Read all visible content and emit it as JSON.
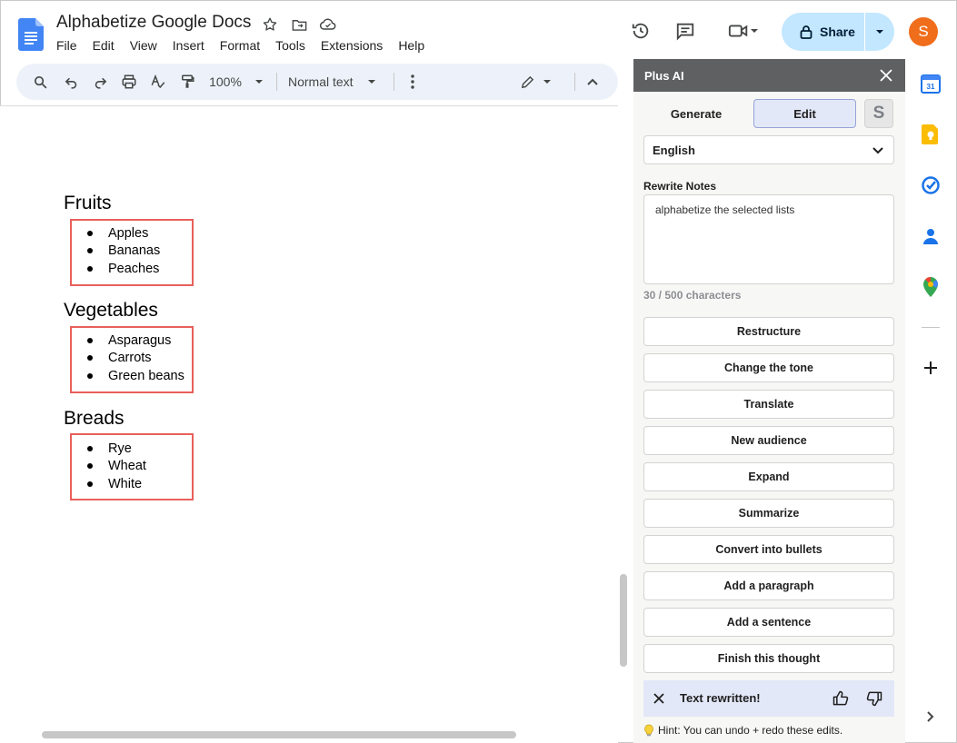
{
  "app": {
    "doc_title": "Alphabetize Google Docs",
    "menu": [
      "File",
      "Edit",
      "View",
      "Insert",
      "Format",
      "Tools",
      "Extensions",
      "Help"
    ],
    "share_label": "Share",
    "avatar_letter": "S"
  },
  "toolbar": {
    "zoom": "100%",
    "style": "Normal text"
  },
  "document": {
    "sections": [
      {
        "heading": "Fruits",
        "items": [
          "Apples",
          "Bananas",
          "Peaches"
        ]
      },
      {
        "heading": "Vegetables",
        "items": [
          "Asparagus",
          "Carrots",
          "Green beans"
        ]
      },
      {
        "heading": "Breads",
        "items": [
          "Rye",
          "Wheat",
          "White"
        ]
      }
    ]
  },
  "panel": {
    "title": "Plus AI",
    "tabs": {
      "generate": "Generate",
      "edit": "Edit",
      "s": "S"
    },
    "language": "English",
    "notes_label": "Rewrite Notes",
    "notes_value": "alphabetize the selected lists",
    "char_count": "30 / 500 characters",
    "actions": [
      "Restructure",
      "Change the tone",
      "Translate",
      "New audience",
      "Expand",
      "Summarize",
      "Convert into bullets",
      "Add a paragraph",
      "Add a sentence",
      "Finish this thought"
    ],
    "toast": "Text rewritten!",
    "hint": "Hint: You can undo + redo these edits."
  },
  "colors": {
    "accent": "#c2e7ff",
    "highlight_border": "#e8605a",
    "avatar": "#f06d1c",
    "panel_header": "#5f6062"
  }
}
